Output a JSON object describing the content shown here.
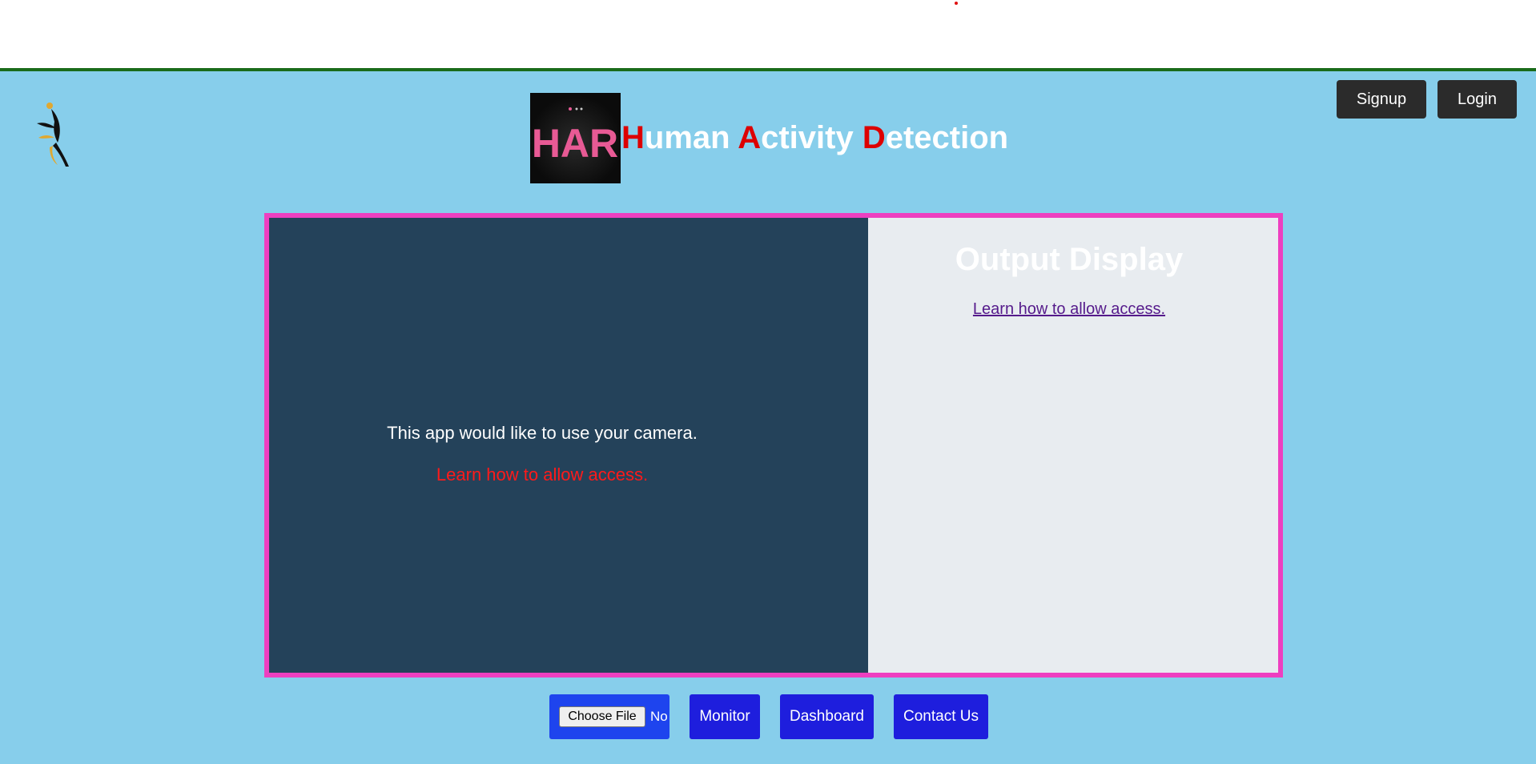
{
  "header": {
    "title_words": [
      {
        "initial": "H",
        "rest": "uman "
      },
      {
        "initial": "A",
        "rest": "ctivity "
      },
      {
        "initial": "D",
        "rest": "etection"
      }
    ],
    "brand_logo_text": "HAR",
    "signup_label": "Signup",
    "login_label": "Login"
  },
  "camera": {
    "message": "This app would like to use your camera.",
    "link": "Learn how to allow access."
  },
  "output": {
    "title": "Output Display",
    "link": "Learn how to allow access."
  },
  "actions": {
    "choose_file_label": "Choose File",
    "file_status": "No file chosen",
    "monitor_label": "Monitor",
    "dashboard_label": "Dashboard",
    "contact_label": "Contact Us"
  },
  "colors": {
    "background": "#87ceeb",
    "title_initial": "#dd0000",
    "frame_border": "#ee3fc0",
    "camera_panel": "#24425a",
    "action_button": "#1e1edd"
  }
}
